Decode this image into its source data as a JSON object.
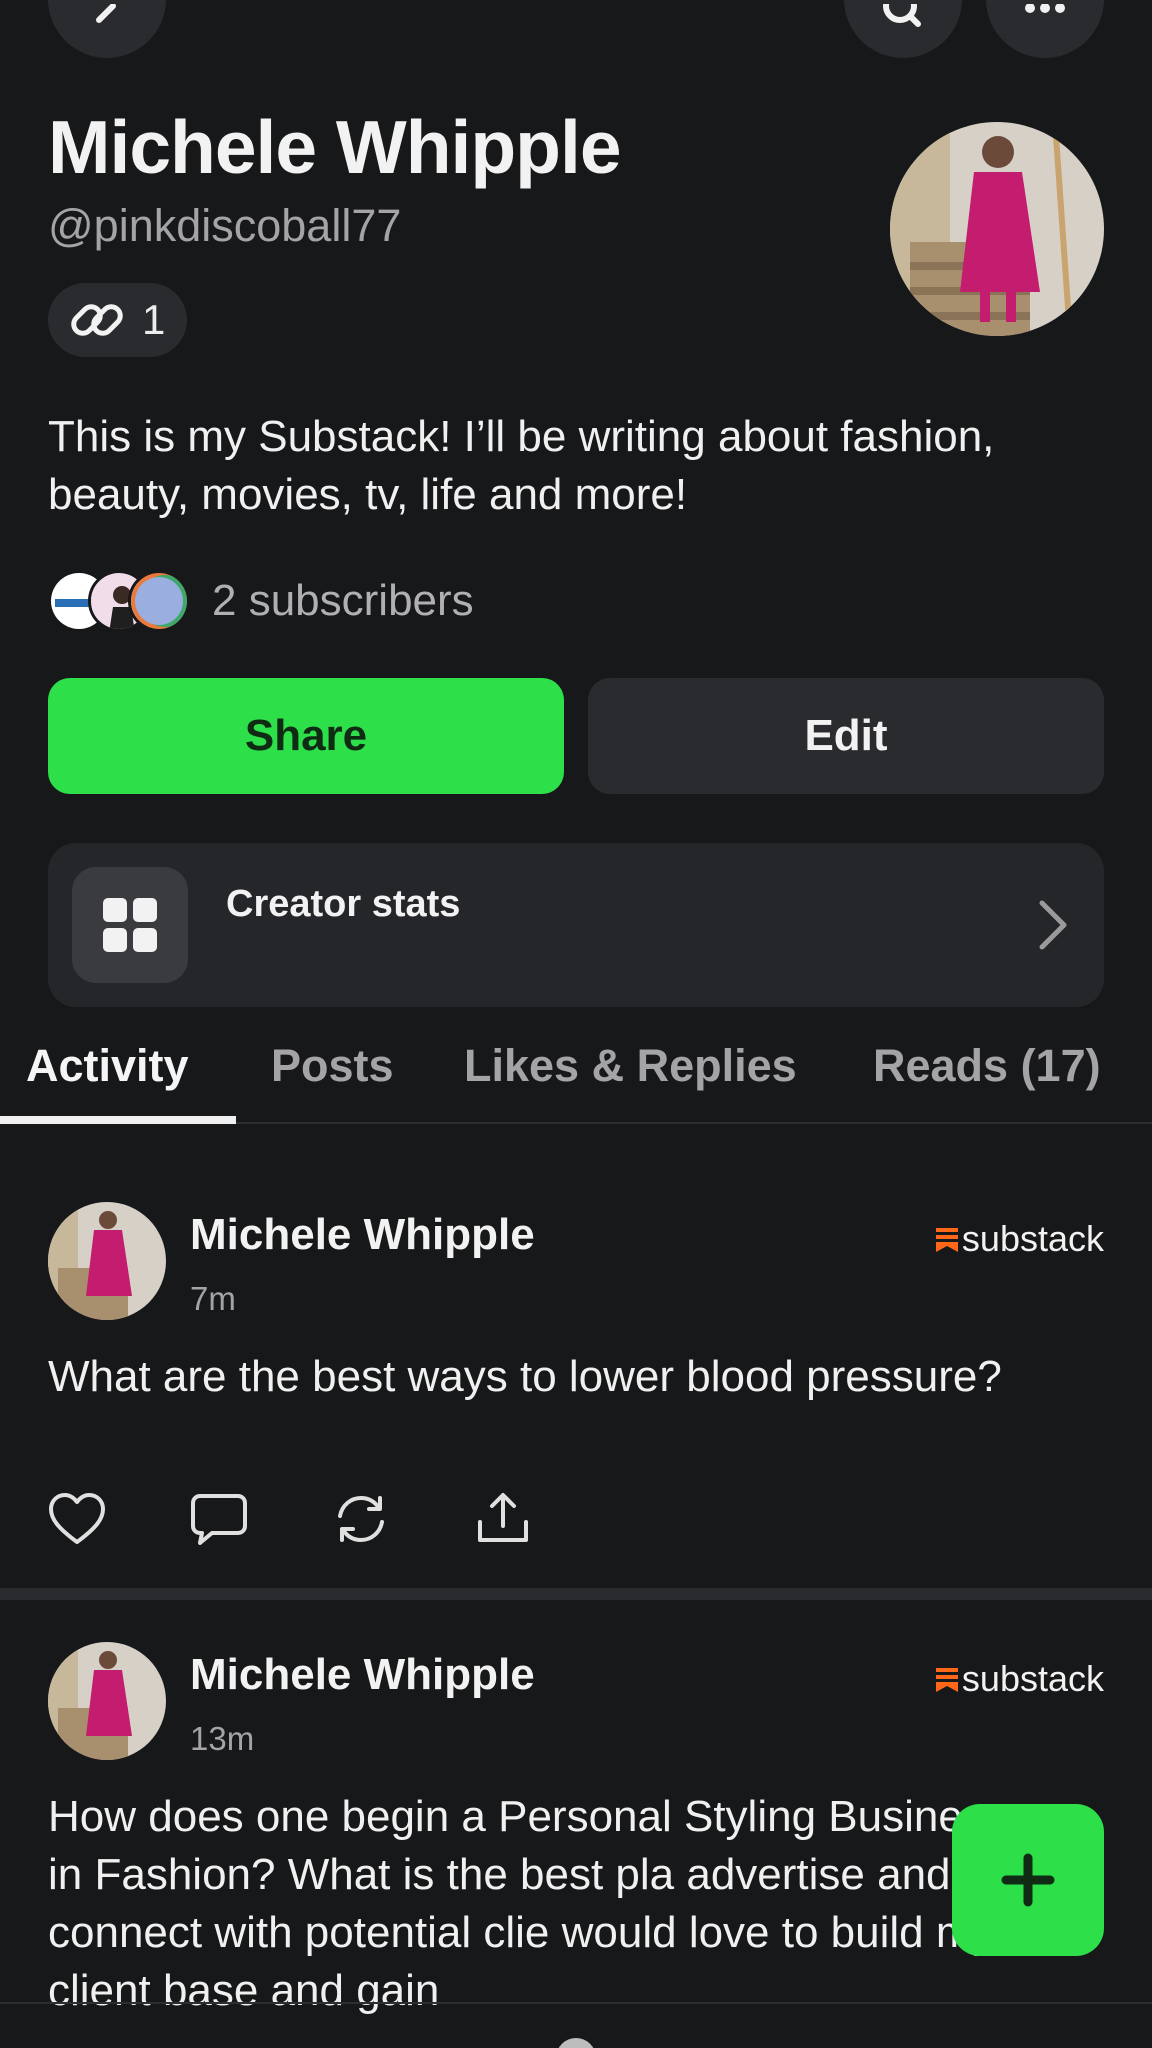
{
  "profile": {
    "name": "Michele Whipple",
    "handle": "@pinkdiscoball77",
    "link_count": "1",
    "bio": "This is my Substack! I’ll be writing about fashion, beauty, movies, tv, life and more!",
    "subscribers": "2 subscribers"
  },
  "buttons": {
    "share": "Share",
    "edit": "Edit"
  },
  "stats_card": {
    "label": "Creator stats"
  },
  "tabs": [
    {
      "label": "Activity",
      "active": true
    },
    {
      "label": "Posts"
    },
    {
      "label": "Likes & Replies"
    },
    {
      "label": "Reads (17)"
    }
  ],
  "posts": [
    {
      "author": "Michele Whipple",
      "time": "7m",
      "brand": "substack",
      "body": "What are the best ways to lower blood pressure?"
    },
    {
      "author": "Michele Whipple",
      "time": "13m",
      "brand": "substack",
      "body": "How does one begin a Personal Styling Business in Fashion? What is the best pla advertise and connect with potential clie would love to build my client base and gain"
    }
  ],
  "colors": {
    "accent": "#2ddf49",
    "background": "#17181a",
    "brand": "#ff6719"
  },
  "icons": {
    "back": "chevron-left-icon",
    "search": "search-icon",
    "more": "more-icon",
    "link": "link-icon",
    "stats": "grid-icon",
    "like": "heart-icon",
    "comment": "comment-icon",
    "restack": "restack-icon",
    "share": "share-icon",
    "compose": "plus-icon"
  }
}
